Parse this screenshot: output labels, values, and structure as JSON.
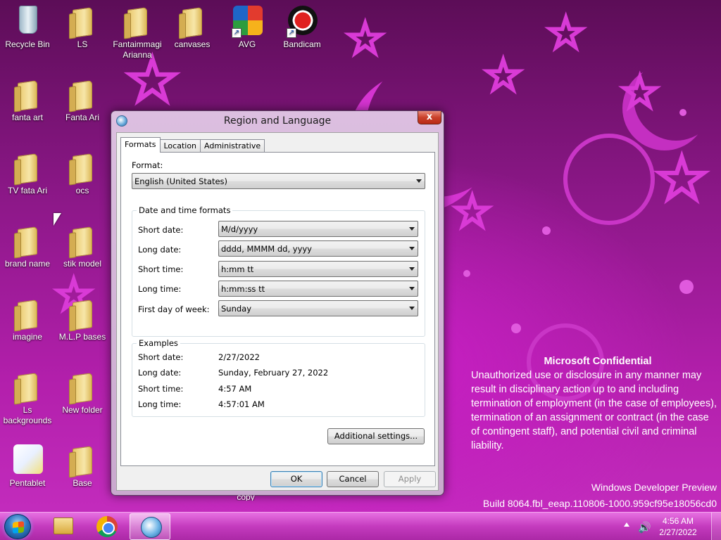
{
  "desktop": {
    "icons": [
      {
        "label": "Recycle Bin",
        "icon": "recycle-bin-icon",
        "kind": "bin"
      },
      {
        "label": "LS",
        "icon": "folder-icon",
        "kind": "folder"
      },
      {
        "label": "Fantaimmagi Arianna",
        "icon": "folder-icon",
        "kind": "folder"
      },
      {
        "label": "canvases",
        "icon": "folder-icon",
        "kind": "folder"
      },
      {
        "label": "AVG",
        "icon": "avg-icon",
        "kind": "app"
      },
      {
        "label": "Bandicam",
        "icon": "bandicam-icon",
        "kind": "app"
      },
      {
        "label": "fanta art",
        "icon": "folder-icon",
        "kind": "folder"
      },
      {
        "label": "Fanta Ari",
        "icon": "folder-icon",
        "kind": "folder"
      },
      {
        "label": "TV fata Ari",
        "icon": "folder-icon",
        "kind": "folder"
      },
      {
        "label": "ocs",
        "icon": "folder-icon",
        "kind": "folder"
      },
      {
        "label": "brand name",
        "icon": "folder-icon",
        "kind": "folder"
      },
      {
        "label": "stik model",
        "icon": "folder-icon",
        "kind": "folder"
      },
      {
        "label": "imagine",
        "icon": "folder-icon",
        "kind": "folder"
      },
      {
        "label": "M.L.P bases",
        "icon": "folder-icon",
        "kind": "folder"
      },
      {
        "label": "Ls backgrounds",
        "icon": "folder-icon",
        "kind": "folder"
      },
      {
        "label": "New folder",
        "icon": "folder-icon",
        "kind": "folder"
      },
      {
        "label": "Pentablet",
        "icon": "pentablet-icon",
        "kind": "app"
      },
      {
        "label": "Base",
        "icon": "folder-icon",
        "kind": "folder"
      }
    ],
    "hidden_label_fragment": "copy"
  },
  "watermark": {
    "title": "Microsoft Confidential",
    "body": "Unauthorized use or disclosure in any manner may result in disciplinary action up to and including termination of employment (in the case of employees), termination of an assignment or contract (in the case of contingent staff), and potential civil and criminal liability.",
    "edition": "Windows Developer Preview",
    "build": "Build 8064.fbl_eeap.110806-1000.959cf95e18056cd0"
  },
  "dialog": {
    "title": "Region and Language",
    "close_label": "x",
    "tabs": [
      "Formats",
      "Location",
      "Administrative"
    ],
    "format_label": "Format:",
    "format_value": "English (United States)",
    "datetime_group_title": "Date and time formats",
    "fields": [
      {
        "label": "Short date:",
        "value": "M/d/yyyy"
      },
      {
        "label": "Long date:",
        "value": "dddd, MMMM dd, yyyy"
      },
      {
        "label": "Short time:",
        "value": "h:mm tt"
      },
      {
        "label": "Long time:",
        "value": "h:mm:ss tt"
      },
      {
        "label": "First day of week:",
        "value": "Sunday"
      }
    ],
    "examples_group_title": "Examples",
    "examples": [
      {
        "label": "Short date:",
        "value": "2/27/2022"
      },
      {
        "label": "Long date:",
        "value": "Sunday, February 27, 2022"
      },
      {
        "label": "Short time:",
        "value": "4:57 AM"
      },
      {
        "label": "Long time:",
        "value": "4:57:01 AM"
      }
    ],
    "additional_settings_label": "Additional settings...",
    "ok_label": "OK",
    "cancel_label": "Cancel",
    "apply_label": "Apply"
  },
  "taskbar": {
    "pinned": [
      {
        "name": "start-button",
        "icon": "windows-orb-icon"
      },
      {
        "name": "explorer",
        "icon": "file-explorer-icon"
      },
      {
        "name": "chrome",
        "icon": "chrome-icon"
      },
      {
        "name": "region-language",
        "icon": "region-language-icon",
        "active": true
      }
    ],
    "clock_time": "4:56 AM",
    "clock_date": "2/27/2022"
  },
  "colors": {
    "accent": "#c62ec0",
    "taskbar": "#c43cbe",
    "close_button": "#c9412b"
  }
}
